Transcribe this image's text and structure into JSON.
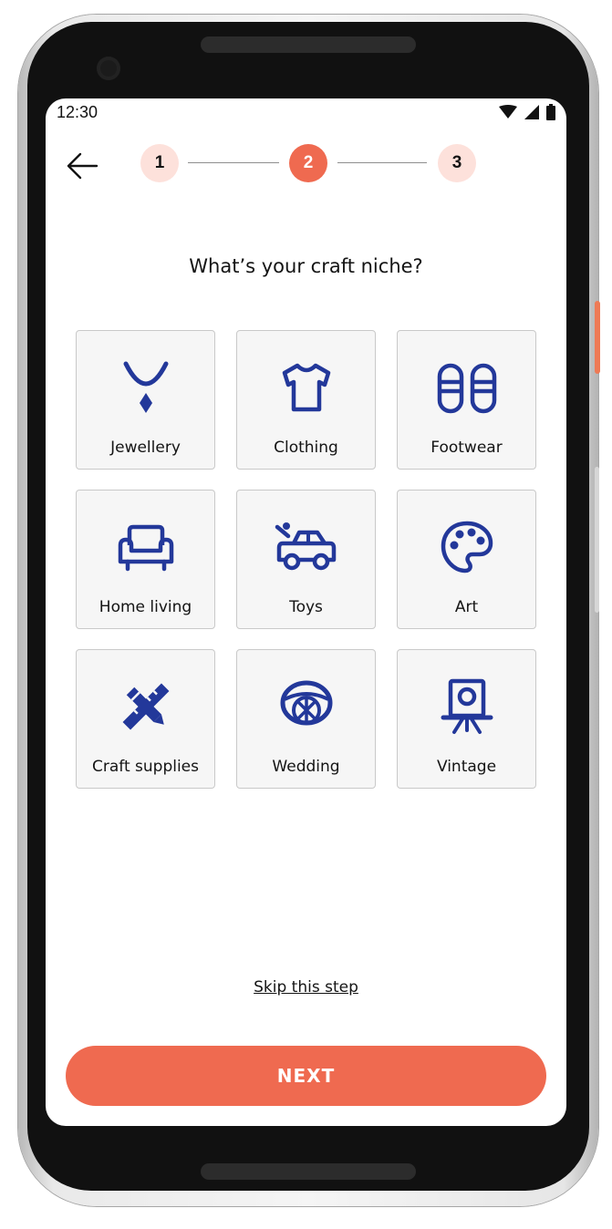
{
  "status_bar": {
    "time": "12:30"
  },
  "stepper": {
    "steps": [
      {
        "label": "1",
        "state": "inactive"
      },
      {
        "label": "2",
        "state": "active"
      },
      {
        "label": "3",
        "state": "inactive"
      }
    ]
  },
  "title": "What’s your craft niche?",
  "categories": [
    {
      "label": "Jewellery",
      "icon": "necklace-icon"
    },
    {
      "label": "Clothing",
      "icon": "tshirt-icon"
    },
    {
      "label": "Footwear",
      "icon": "sandals-icon"
    },
    {
      "label": "Home living",
      "icon": "armchair-icon"
    },
    {
      "label": "Toys",
      "icon": "toy-car-icon"
    },
    {
      "label": "Art",
      "icon": "palette-icon"
    },
    {
      "label": "Craft supplies",
      "icon": "pencil-ruler-icon"
    },
    {
      "label": "Wedding",
      "icon": "ring-icon"
    },
    {
      "label": "Vintage",
      "icon": "vintage-camera-icon"
    }
  ],
  "skip_label": "Skip this step",
  "next_label": "NEXT",
  "colors": {
    "accent": "#ef6a50",
    "accent_light": "#fde1db",
    "icon": "#23389a",
    "tile_bg": "#f6f6f6"
  }
}
